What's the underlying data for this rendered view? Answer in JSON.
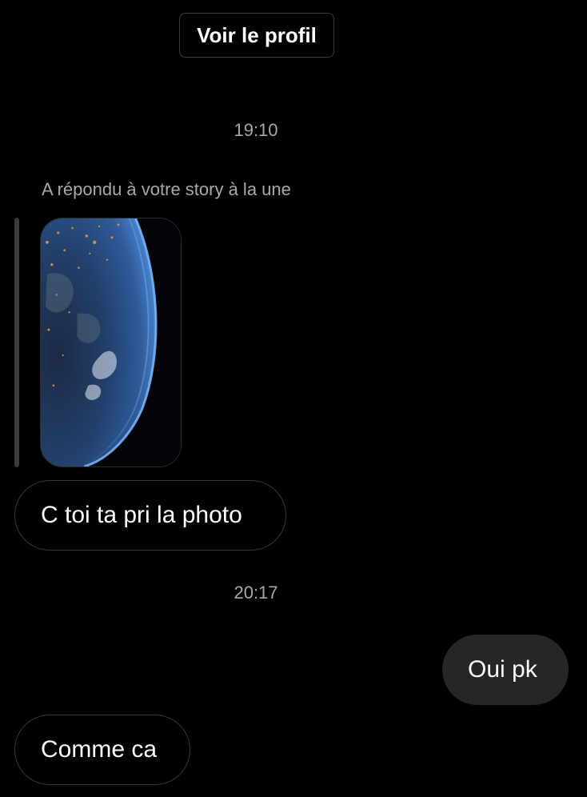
{
  "header": {
    "view_profile_label": "Voir le profil"
  },
  "thread": {
    "timestamp_1": "19:10",
    "story_reply_label": "A répondu à votre story à la une",
    "story_image": {
      "icon": "earth-from-space-photo"
    },
    "message_1": "C toi ta pri la photo",
    "timestamp_2": "20:17",
    "message_2": "Oui pk",
    "message_3": "Comme ca"
  },
  "colors": {
    "background": "#000000",
    "secondary_text": "#a8a8a8",
    "outgoing_bubble": "#262626",
    "incoming_border": "#363636"
  }
}
